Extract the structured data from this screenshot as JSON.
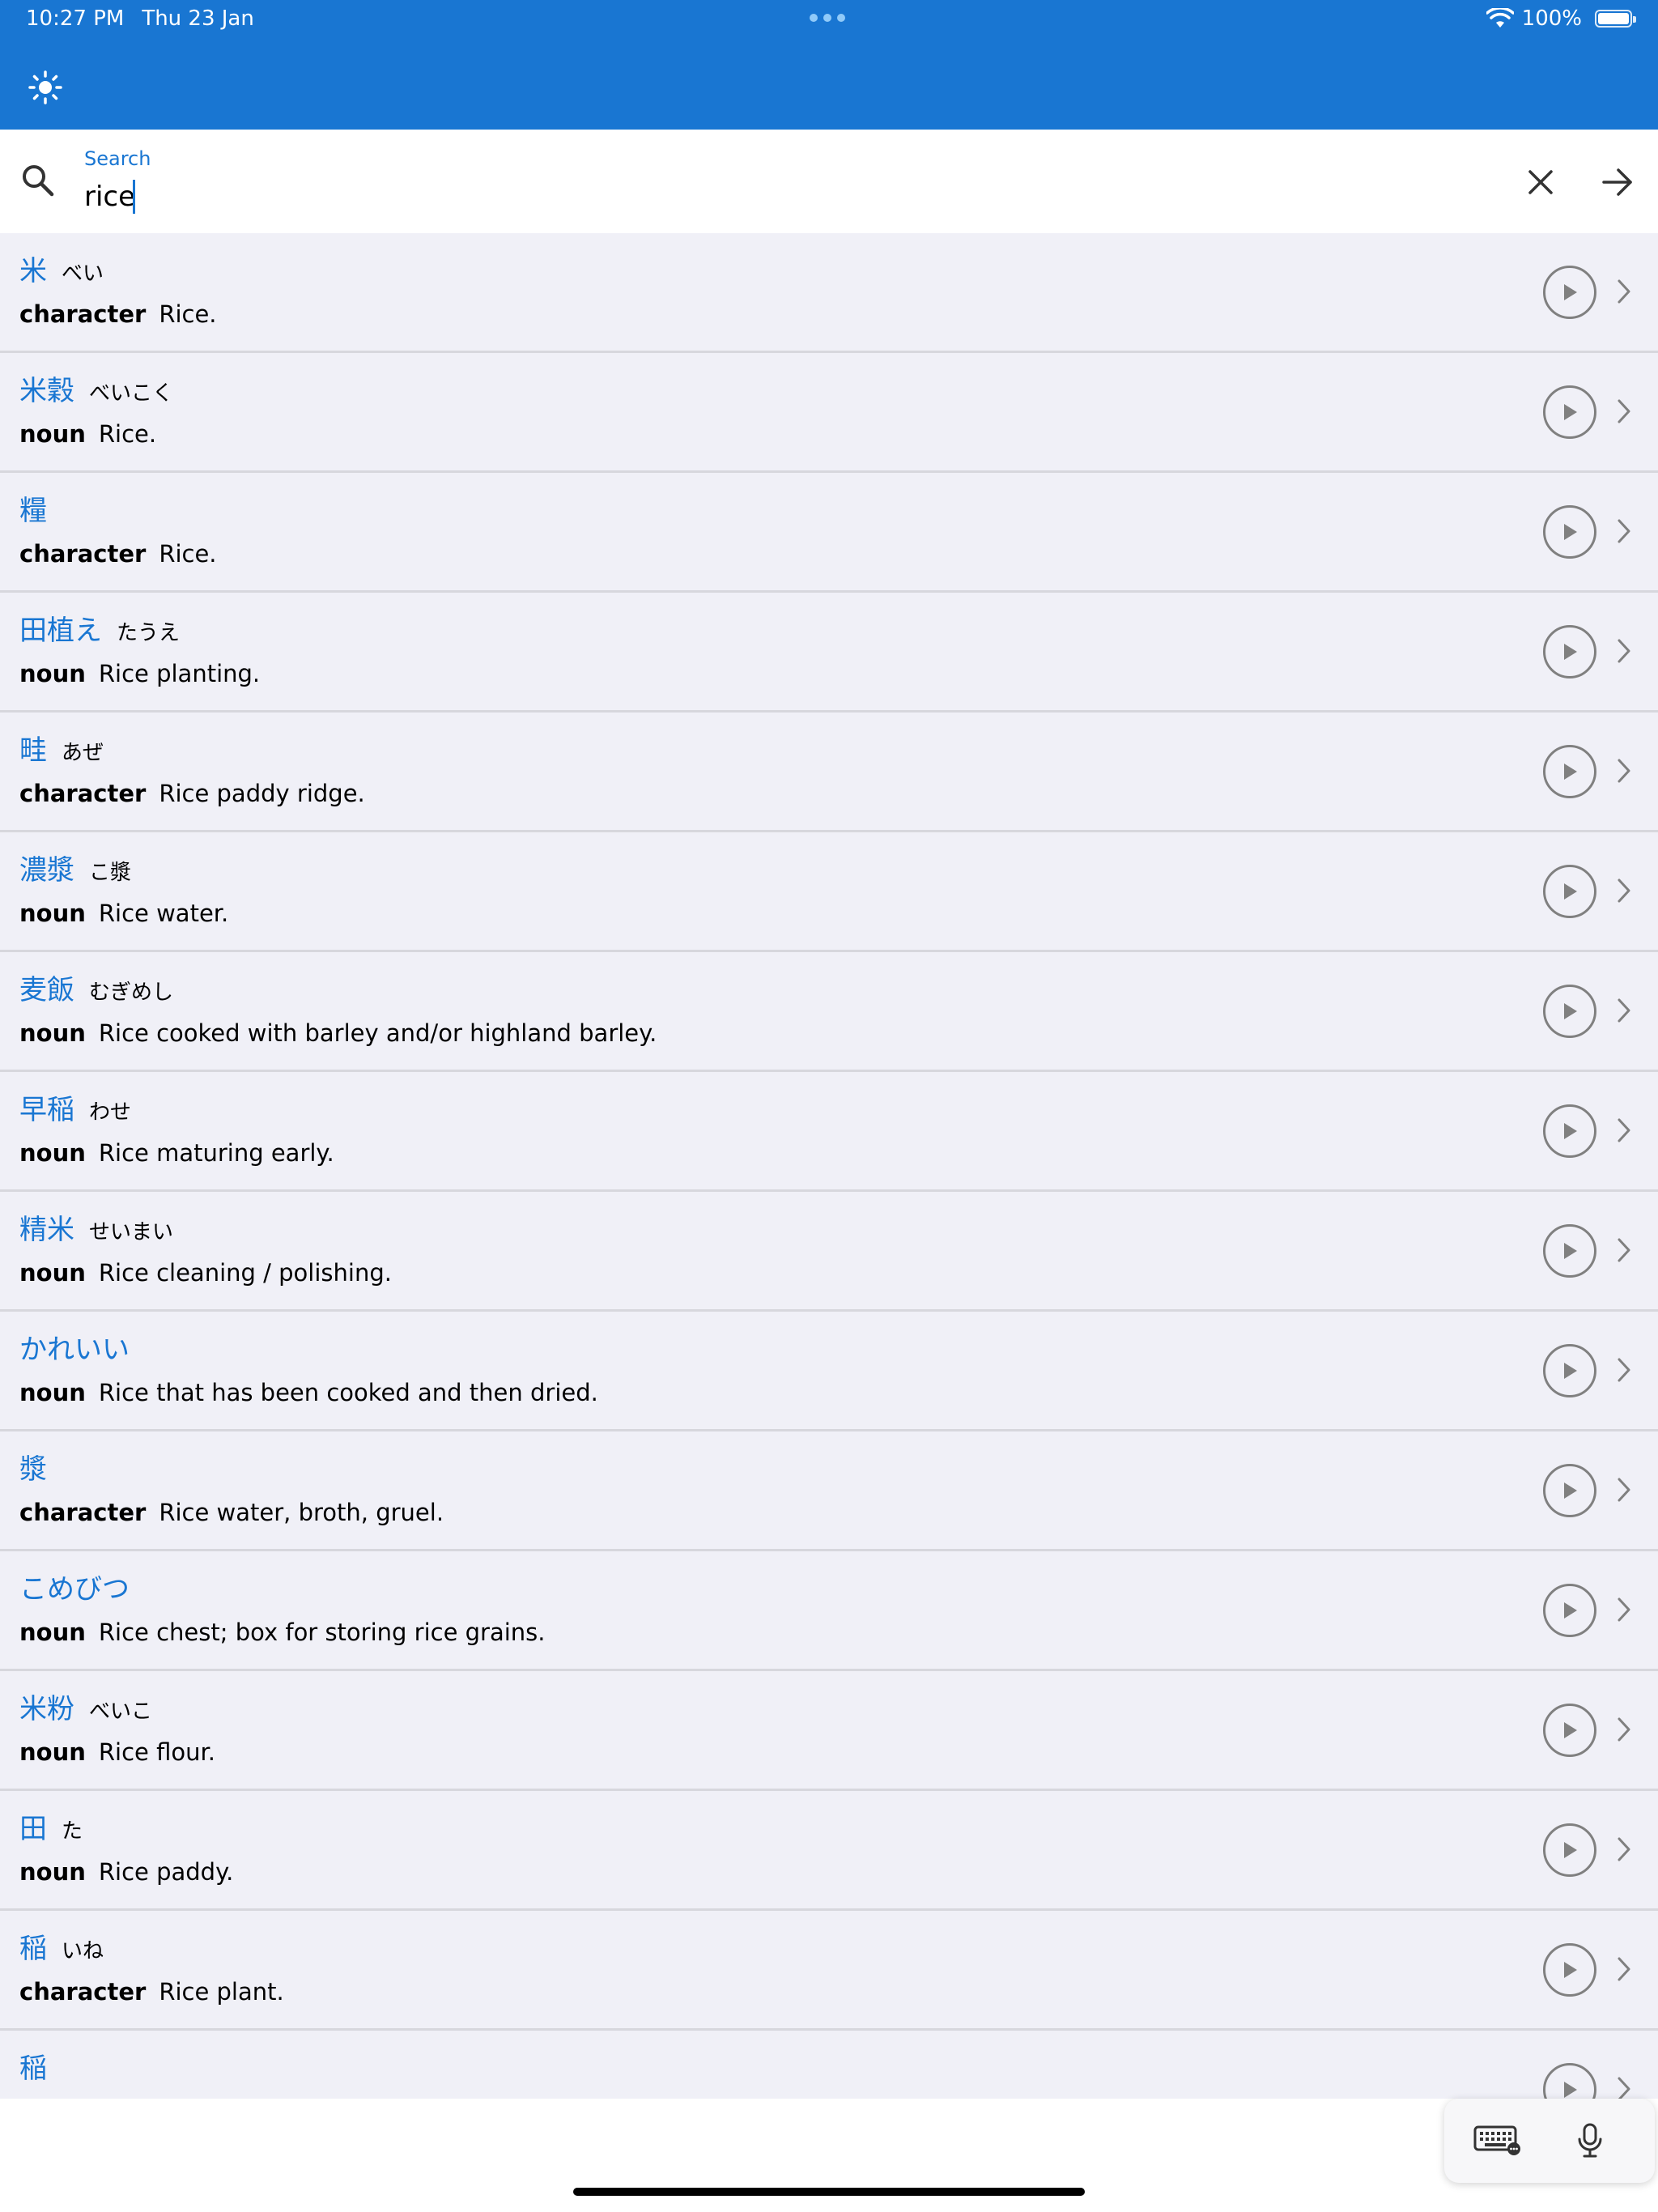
{
  "status_bar": {
    "time": "10:27 PM",
    "date": "Thu 23 Jan",
    "battery": "100%"
  },
  "search": {
    "label": "Search",
    "value": "rice"
  },
  "results": [
    {
      "word": "米",
      "reading": "べい",
      "pos": "character",
      "definition": "Rice."
    },
    {
      "word": "米穀",
      "reading": "べいこく",
      "pos": "noun",
      "definition": "Rice."
    },
    {
      "word": "糧",
      "reading": "",
      "pos": "character",
      "definition": "Rice."
    },
    {
      "word": "田植え",
      "reading": "たうえ",
      "pos": "noun",
      "definition": "Rice planting."
    },
    {
      "word": "畦",
      "reading": "あぜ",
      "pos": "character",
      "definition": "Rice paddy ridge."
    },
    {
      "word": "濃漿",
      "reading": "こ漿",
      "pos": "noun",
      "definition": "Rice water."
    },
    {
      "word": "麦飯",
      "reading": "むぎめし",
      "pos": "noun",
      "definition": "Rice cooked with barley and/or highland barley."
    },
    {
      "word": "早稲",
      "reading": "わせ",
      "pos": "noun",
      "definition": "Rice maturing early."
    },
    {
      "word": "精米",
      "reading": "せいまい",
      "pos": "noun",
      "definition": "Rice cleaning / polishing."
    },
    {
      "word": "かれいい",
      "reading": "",
      "pos": "noun",
      "definition": "Rice that has been cooked and then dried."
    },
    {
      "word": "漿",
      "reading": "",
      "pos": "character",
      "definition": "Rice water, broth, gruel."
    },
    {
      "word": "こめびつ",
      "reading": "",
      "pos": "noun",
      "definition": "Rice chest; box for storing rice grains."
    },
    {
      "word": "米粉",
      "reading": "べいこ",
      "pos": "noun",
      "definition": "Rice flour."
    },
    {
      "word": "田",
      "reading": "た",
      "pos": "noun",
      "definition": "Rice paddy."
    },
    {
      "word": "稲",
      "reading": "いね",
      "pos": "character",
      "definition": "Rice plant."
    },
    {
      "word": "稲",
      "reading": "",
      "pos": "",
      "definition": ""
    }
  ],
  "icons": {
    "theme": "sun-icon",
    "search": "search-icon",
    "clear": "close-icon",
    "submit": "arrow-right-icon",
    "play": "play-icon",
    "row_action": "chevron-right-icon",
    "keyboard": "keyboard-icon",
    "dictation": "microphone-icon"
  },
  "colors": {
    "brand": "#1976d2",
    "list_background": "#f0f0f7",
    "divider": "#d7d7dd",
    "icon_gray": "#808080"
  }
}
